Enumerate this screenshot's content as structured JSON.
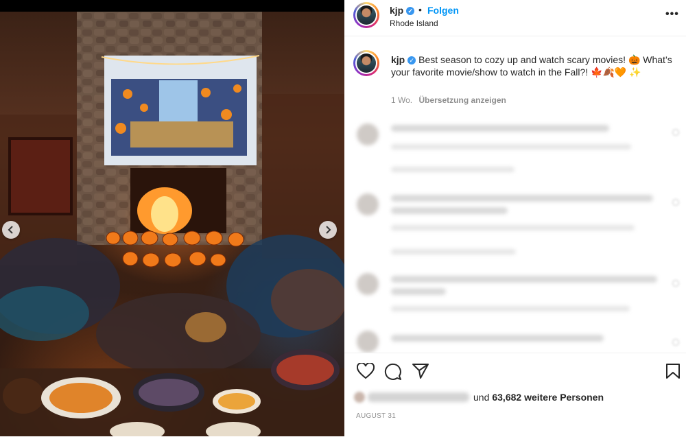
{
  "post": {
    "username": "kjp",
    "follow_label": "Folgen",
    "location": "Rhode Island",
    "more_label": "•••",
    "separator": "•"
  },
  "caption": {
    "username": "kjp",
    "text": "Best season to cozy up and watch scary movies! 🎃 What’s your favorite movie/show to watch in the Fall?! 🍁🍂🧡 ✨",
    "age": "1 Wo.",
    "translate_label": "Übersetzung anzeigen"
  },
  "likes": {
    "suffix": "und",
    "count_text": "63,682 weitere Personen"
  },
  "date": "AUGUST 31",
  "icons": [
    "heart-icon",
    "comment-icon",
    "share-icon",
    "bookmark-icon",
    "chevron-left-icon",
    "chevron-right-icon",
    "verified-icon",
    "more-icon"
  ],
  "colors": {
    "follow": "#0095f6",
    "verified": "#3897f0",
    "muted": "#8e8e8e"
  }
}
